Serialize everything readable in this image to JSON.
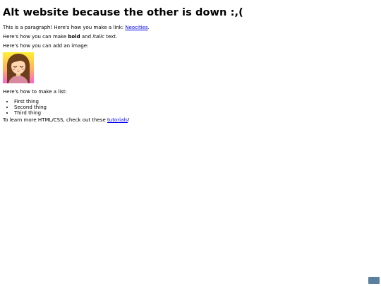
{
  "heading": "Alt website because the other is down :,(",
  "p1": {
    "before": "This is a paragraph! Here's how you make a link: ",
    "link": "Neocities",
    "after": "."
  },
  "p2": {
    "before": "Here's how you can make ",
    "bold": "bold",
    "middle": " and ",
    "italic": "italic",
    "after": " text."
  },
  "p3": "Here's how you can add an image:",
  "p4": "Here's how to make a list:",
  "list": [
    "First thing",
    "Second thing",
    "Third thing"
  ],
  "p5": {
    "before": "To learn more HTML/CSS, check out these ",
    "link": "tutorials",
    "after": "!"
  },
  "colors": {
    "link": "#0000ee",
    "avatar_bg_top": "#ffe93a",
    "avatar_bg_bottom": "#ff6ad0",
    "hair": "#6b3f1c",
    "skin": "#ffd6b0",
    "badge": "#5b7f9e"
  }
}
